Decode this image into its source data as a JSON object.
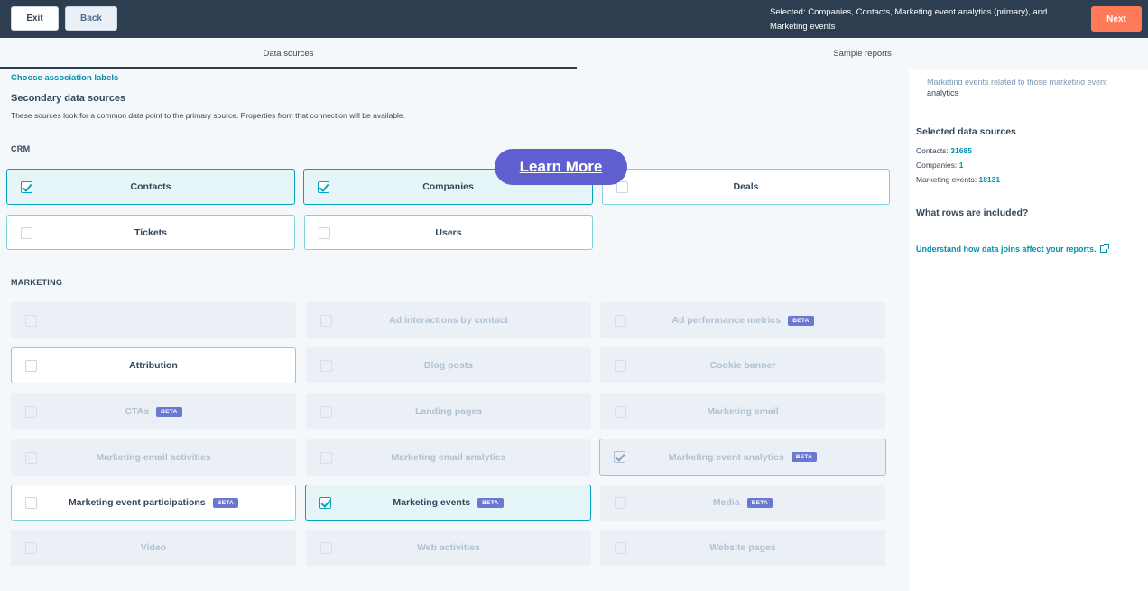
{
  "topbar": {
    "exit_label": "Exit",
    "back_label": "Back",
    "selected_summary": "Selected: Companies, Contacts, Marketing event analytics (primary), and Marketing events",
    "next_label": "Next"
  },
  "tabs": [
    {
      "label": "Data sources",
      "active": true
    },
    {
      "label": "Sample reports",
      "active": false
    }
  ],
  "main": {
    "choose_link": "Choose association labels",
    "secondary_title": "Secondary data sources",
    "secondary_desc": "These sources look for a common data point to the primary source. Properties from that connection will be available.",
    "crm_label": "CRM",
    "marketing_label": "MARKETING",
    "crm": [
      {
        "label": "Contacts",
        "checked": true,
        "state": "checked"
      },
      {
        "label": "Companies",
        "checked": true,
        "state": "checked"
      },
      {
        "label": "Deals",
        "checked": false,
        "state": "enabled"
      },
      {
        "label": "Tickets",
        "checked": false,
        "state": "enabled"
      },
      {
        "label": "Users",
        "checked": false,
        "state": "enabled"
      }
    ],
    "marketing": [
      {
        "label": "",
        "state": "disabled"
      },
      {
        "label": "Ad interactions by contact",
        "state": "disabled"
      },
      {
        "label": "Ad performance metrics",
        "state": "disabled",
        "beta": "BETA"
      },
      {
        "label": "Attribution",
        "state": "enabled"
      },
      {
        "label": "Blog posts",
        "state": "disabled"
      },
      {
        "label": "Cookie banner",
        "state": "disabled"
      },
      {
        "label": "CTAs",
        "state": "disabled",
        "beta": "BETA"
      },
      {
        "label": "Landing pages",
        "state": "disabled"
      },
      {
        "label": "Marketing email",
        "state": "disabled"
      },
      {
        "label": "Marketing email activities",
        "state": "disabled"
      },
      {
        "label": "Marketing email analytics",
        "state": "disabled"
      },
      {
        "label": "Marketing event analytics",
        "state": "disabled-checked",
        "beta": "BETA"
      },
      {
        "label": "Marketing event participations",
        "state": "enabled",
        "beta": "BETA"
      },
      {
        "label": "Marketing events",
        "state": "checked",
        "beta": "BETA"
      },
      {
        "label": "Media",
        "state": "disabled",
        "beta": "BETA"
      },
      {
        "label": "Video",
        "state": "disabled"
      },
      {
        "label": "Web activities",
        "state": "disabled"
      },
      {
        "label": "Website pages",
        "state": "disabled"
      }
    ]
  },
  "overlay": {
    "learn_more": "Learn More"
  },
  "right_panel": {
    "cut_text_1": "Marketing events related to those marketing event",
    "cut_text_2": "analytics",
    "selected_title": "Selected data sources",
    "contacts_label": "Contacts:",
    "contacts_count": "31685",
    "companies_label": "Companies:",
    "companies_count": "1",
    "events_label": "Marketing events:",
    "events_count": "18131",
    "rows_title": "What rows are included?",
    "joins_link": "Understand how data joins affect your reports."
  },
  "colors": {
    "topbar": "#2d3e50",
    "next_button": "#ff7a59",
    "accent": "#00a4bd",
    "link": "#0091ae",
    "beta": "#6a78d1",
    "learn_more": "#5f5fcf"
  }
}
